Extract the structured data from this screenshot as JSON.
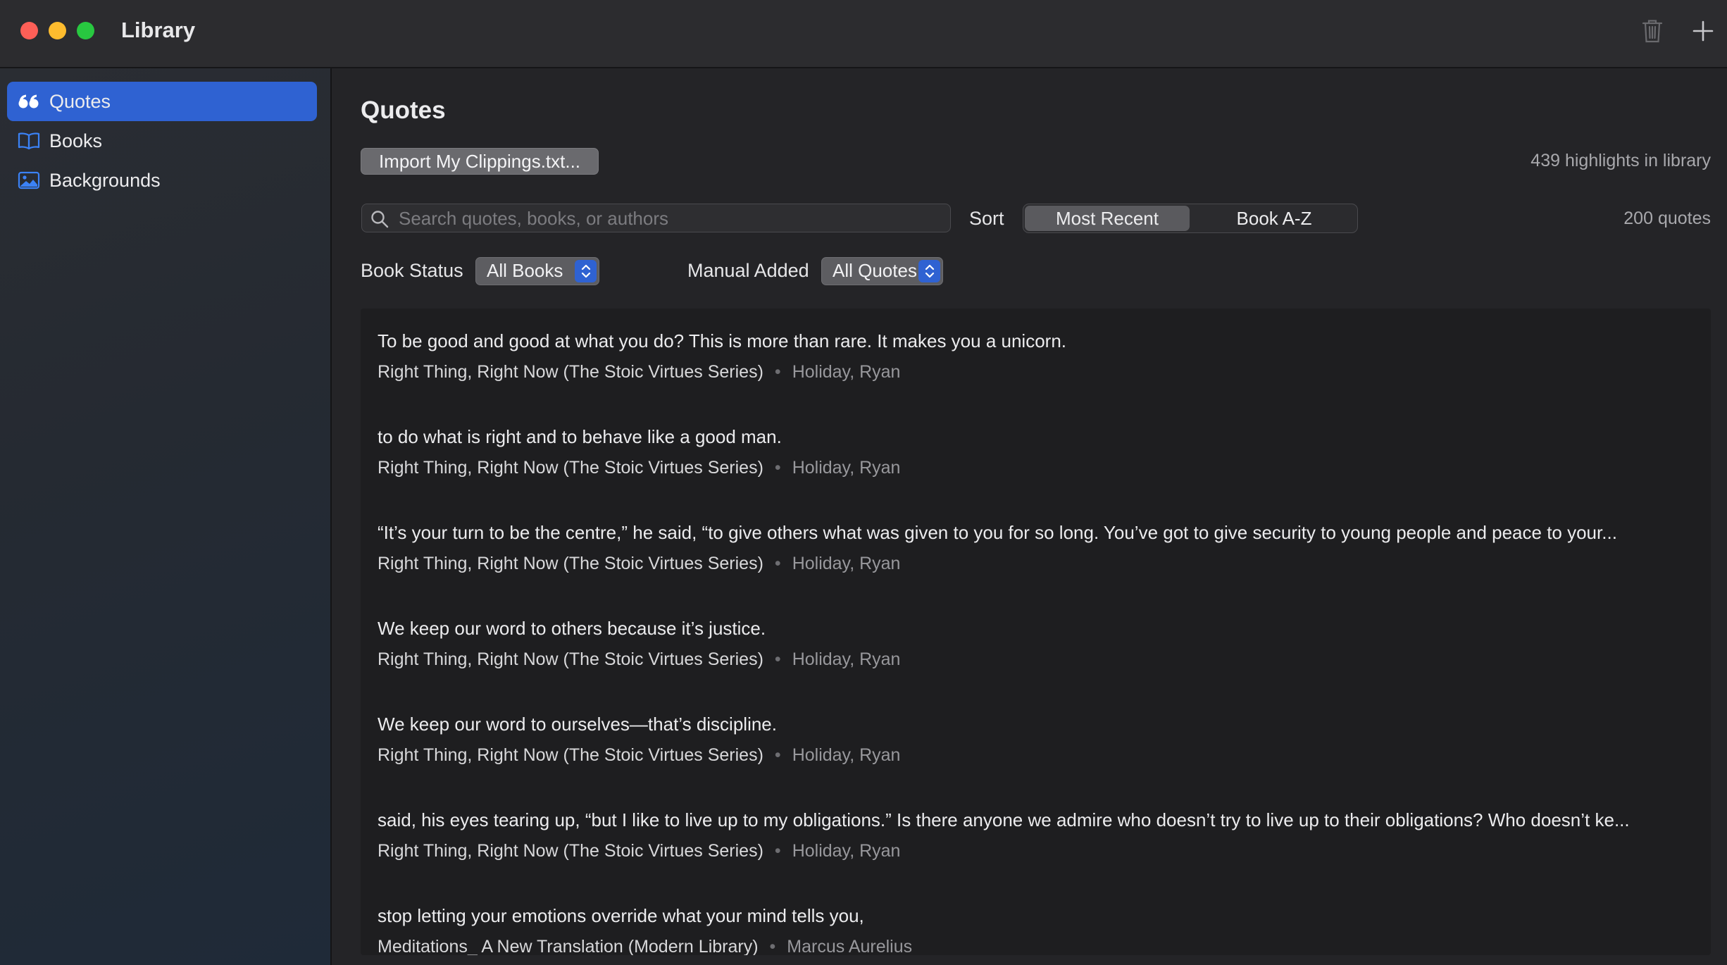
{
  "window": {
    "title": "Library"
  },
  "sidebar": {
    "items": [
      {
        "label": "Quotes",
        "icon": "quote-icon",
        "active": true
      },
      {
        "label": "Books",
        "icon": "book-icon",
        "active": false
      },
      {
        "label": "Backgrounds",
        "icon": "photo-icon",
        "active": false
      }
    ]
  },
  "main": {
    "title": "Quotes",
    "import_label": "Import My Clippings.txt...",
    "highlights_count": "439 highlights in library",
    "search": {
      "placeholder": "Search quotes, books, or authors",
      "value": ""
    },
    "sort": {
      "label": "Sort",
      "options": [
        "Most Recent",
        "Book A-Z"
      ],
      "selected": "Most Recent"
    },
    "quotes_count": "200 quotes",
    "filters": {
      "book_status": {
        "label": "Book Status",
        "value": "All Books"
      },
      "manual_added": {
        "label": "Manual Added",
        "value": "All Quotes"
      }
    },
    "quotes": [
      {
        "text": "To be good and good at what you do? This is more than rare. It makes you a unicorn.",
        "book": "Right Thing, Right Now (The Stoic Virtues Series)",
        "author": "Holiday, Ryan"
      },
      {
        "text": "to do what is right and to behave like a good man.",
        "book": "Right Thing, Right Now (The Stoic Virtues Series)",
        "author": "Holiday, Ryan"
      },
      {
        "text": "“It’s your turn to be the centre,” he said, “to give others what was given to you for so long. You’ve got to give security to young people and peace to your...",
        "book": "Right Thing, Right Now (The Stoic Virtues Series)",
        "author": "Holiday, Ryan"
      },
      {
        "text": "We keep our word to others because it’s justice.",
        "book": "Right Thing, Right Now (The Stoic Virtues Series)",
        "author": "Holiday, Ryan"
      },
      {
        "text": "We keep our word to ourselves—that’s discipline.",
        "book": "Right Thing, Right Now (The Stoic Virtues Series)",
        "author": "Holiday, Ryan"
      },
      {
        "text": "said, his eyes tearing up, “but I like to live up to my obligations.” Is there anyone we admire who doesn’t try to live up to their obligations? Who doesn’t ke...",
        "book": "Right Thing, Right Now (The Stoic Virtues Series)",
        "author": "Holiday, Ryan"
      },
      {
        "text": "stop letting your emotions override what your mind tells you,",
        "book": "Meditations_ A New Translation (Modern Library)",
        "author": "Marcus Aurelius"
      }
    ]
  },
  "colors": {
    "accent": "#2f62d2",
    "close": "#fe5f57",
    "minimize": "#febc2e",
    "zoom": "#28c840"
  }
}
